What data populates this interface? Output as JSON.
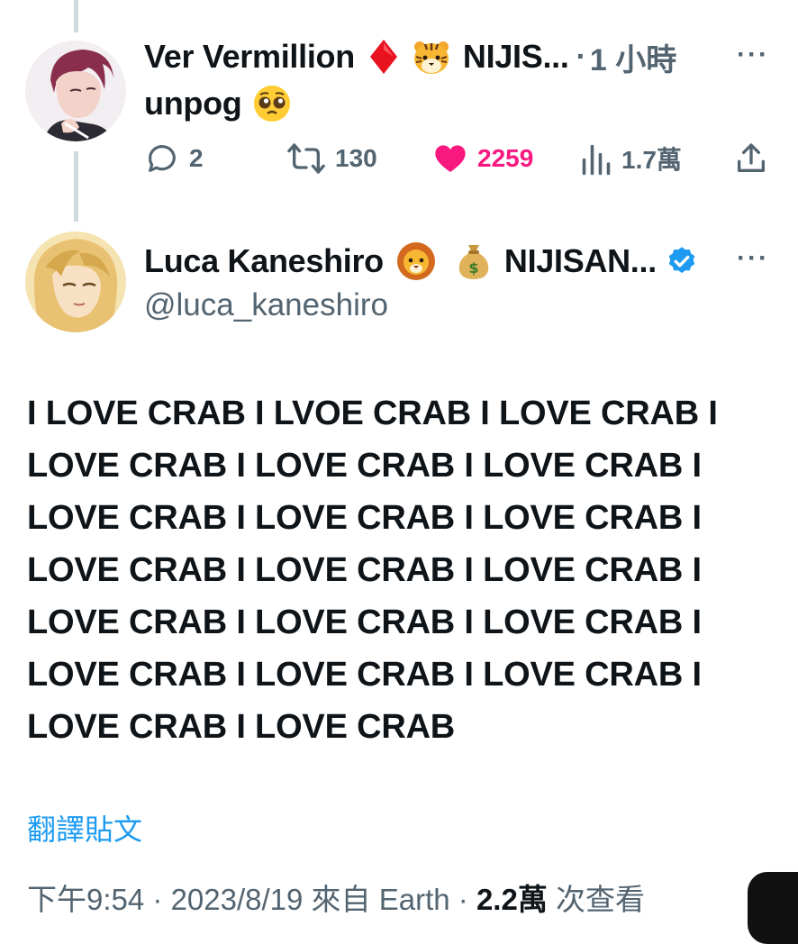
{
  "reply_tweet": {
    "author_name": "Ver Vermillion",
    "name_suffix": "NIJIS...",
    "separator": "·",
    "time": "1 小時",
    "text": "unpog",
    "emojis": [
      "red-diamond",
      "tiger-face",
      "pleading-face"
    ],
    "actions": {
      "replies": "2",
      "retweets": "130",
      "likes": "2259",
      "views": "1.7萬"
    },
    "like_color": "#f91880"
  },
  "main_tweet": {
    "author_name": "Luca Kaneshiro",
    "name_suffix": "NIJISAN...",
    "handle": "@luca_kaneshiro",
    "verified": true,
    "verified_color": "#1d9bf0",
    "emojis": [
      "lion-face",
      "money-bag"
    ],
    "text": "I LOVE CRAB I LVOE CRAB I LOVE CRAB I LOVE CRAB I LOVE CRAB I LOVE CRAB I LOVE CRAB I LOVE CRAB I LOVE CRAB I LOVE CRAB I LOVE CRAB I LOVE CRAB I LOVE CRAB I LOVE CRAB I LOVE CRAB I LOVE CRAB I LOVE CRAB I LOVE CRAB I LOVE CRAB I LOVE CRAB",
    "translate_label": "翻譯貼文",
    "meta": {
      "time": "下午9:54",
      "sep1": "·",
      "date": "2023/8/19 來自 Earth",
      "sep2": "·",
      "views_count": "2.2萬",
      "views_label": "次查看"
    }
  },
  "colors": {
    "accent": "#1d9bf0",
    "muted": "#536471",
    "text": "#0f1419",
    "thread_line": "#cfd9de"
  }
}
